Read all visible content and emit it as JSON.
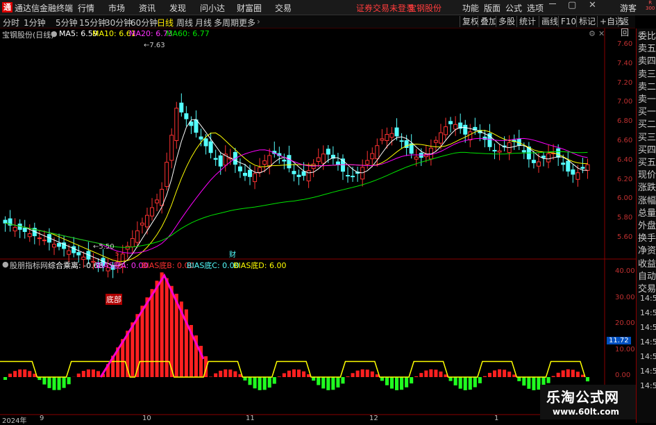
{
  "app": {
    "title": "通达信金融终端",
    "logo": "tdx-logo-icon"
  },
  "menu": [
    "行情",
    "市场",
    "资讯",
    "发现",
    "问小达",
    "财富圈",
    "交易"
  ],
  "status_warning": {
    "not_logged": "证券交易未登录",
    "stock": "宝钢股份"
  },
  "menu_right": [
    "功能",
    "版面",
    "公式",
    "选项"
  ],
  "guest": "游客",
  "r_badge": {
    "top": "R",
    "bottom": "300"
  },
  "periods": [
    "分时",
    "1分钟",
    "5分钟",
    "15分钟",
    "30分钟",
    "60分钟",
    "日线",
    "周线",
    "月线",
    "多周期",
    "更多"
  ],
  "active_period": "日线",
  "toolbar_right": [
    "复权",
    "叠加",
    "多股",
    "统计",
    "画线",
    "F10",
    "标记",
    "+自选",
    "返回"
  ],
  "stock_label": "宝钢股份(日线)",
  "ma_legend": {
    "ma5": "MA5: 6.59",
    "ma10": "MA10: 6.61",
    "ma20": "MA20: 6.73",
    "ma60": "MA60: 6.77"
  },
  "colors": {
    "up": "#ff3232",
    "down": "#54ffff",
    "ma5": "#ffffff",
    "ma10": "#ffff00",
    "ma20": "#ff00ff",
    "ma60": "#00e600",
    "bg": "#000000"
  },
  "price_axis": [
    "7.60",
    "7.40",
    "7.20",
    "7.00",
    "6.80",
    "6.60",
    "6.40",
    "6.20",
    "6.00",
    "5.80",
    "5.60"
  ],
  "annotations": {
    "high": "7.63",
    "low": "5.50",
    "marker_s": "s",
    "marker_cai": "财"
  },
  "indicator": {
    "name": "股朋指标网",
    "composite": "综合乘离: -0.68",
    "bias_a": "BIAS底A: 0.00",
    "bias_b": "BIAS底B: 0.00",
    "bias_c": "BIAS底C: 0.00",
    "bias_d": "BIAS底D: 6.00",
    "bottom_label": "底部",
    "current_value": "11.72"
  },
  "indicator_axis": [
    "40.00",
    "30.00",
    "20.00",
    "10.00",
    "0.00"
  ],
  "date_axis": [
    "2024年",
    "9",
    "10",
    "11",
    "12",
    "1"
  ],
  "side_panel": [
    "委比",
    "卖五",
    "卖四",
    "卖三",
    "卖二",
    "卖一",
    "买一",
    "买二",
    "买三",
    "买四",
    "买五",
    "现价",
    "涨跌",
    "涨幅",
    "总量",
    "外盘",
    "换手",
    "净资",
    "收益",
    "自动",
    "交易"
  ],
  "side_times": [
    "14:56",
    "14:56",
    "14:56",
    "14:56",
    "14:56",
    "14:56",
    "14:56"
  ],
  "watermark": {
    "title": "乐淘公式网",
    "url": "www.60lt.com"
  }
}
